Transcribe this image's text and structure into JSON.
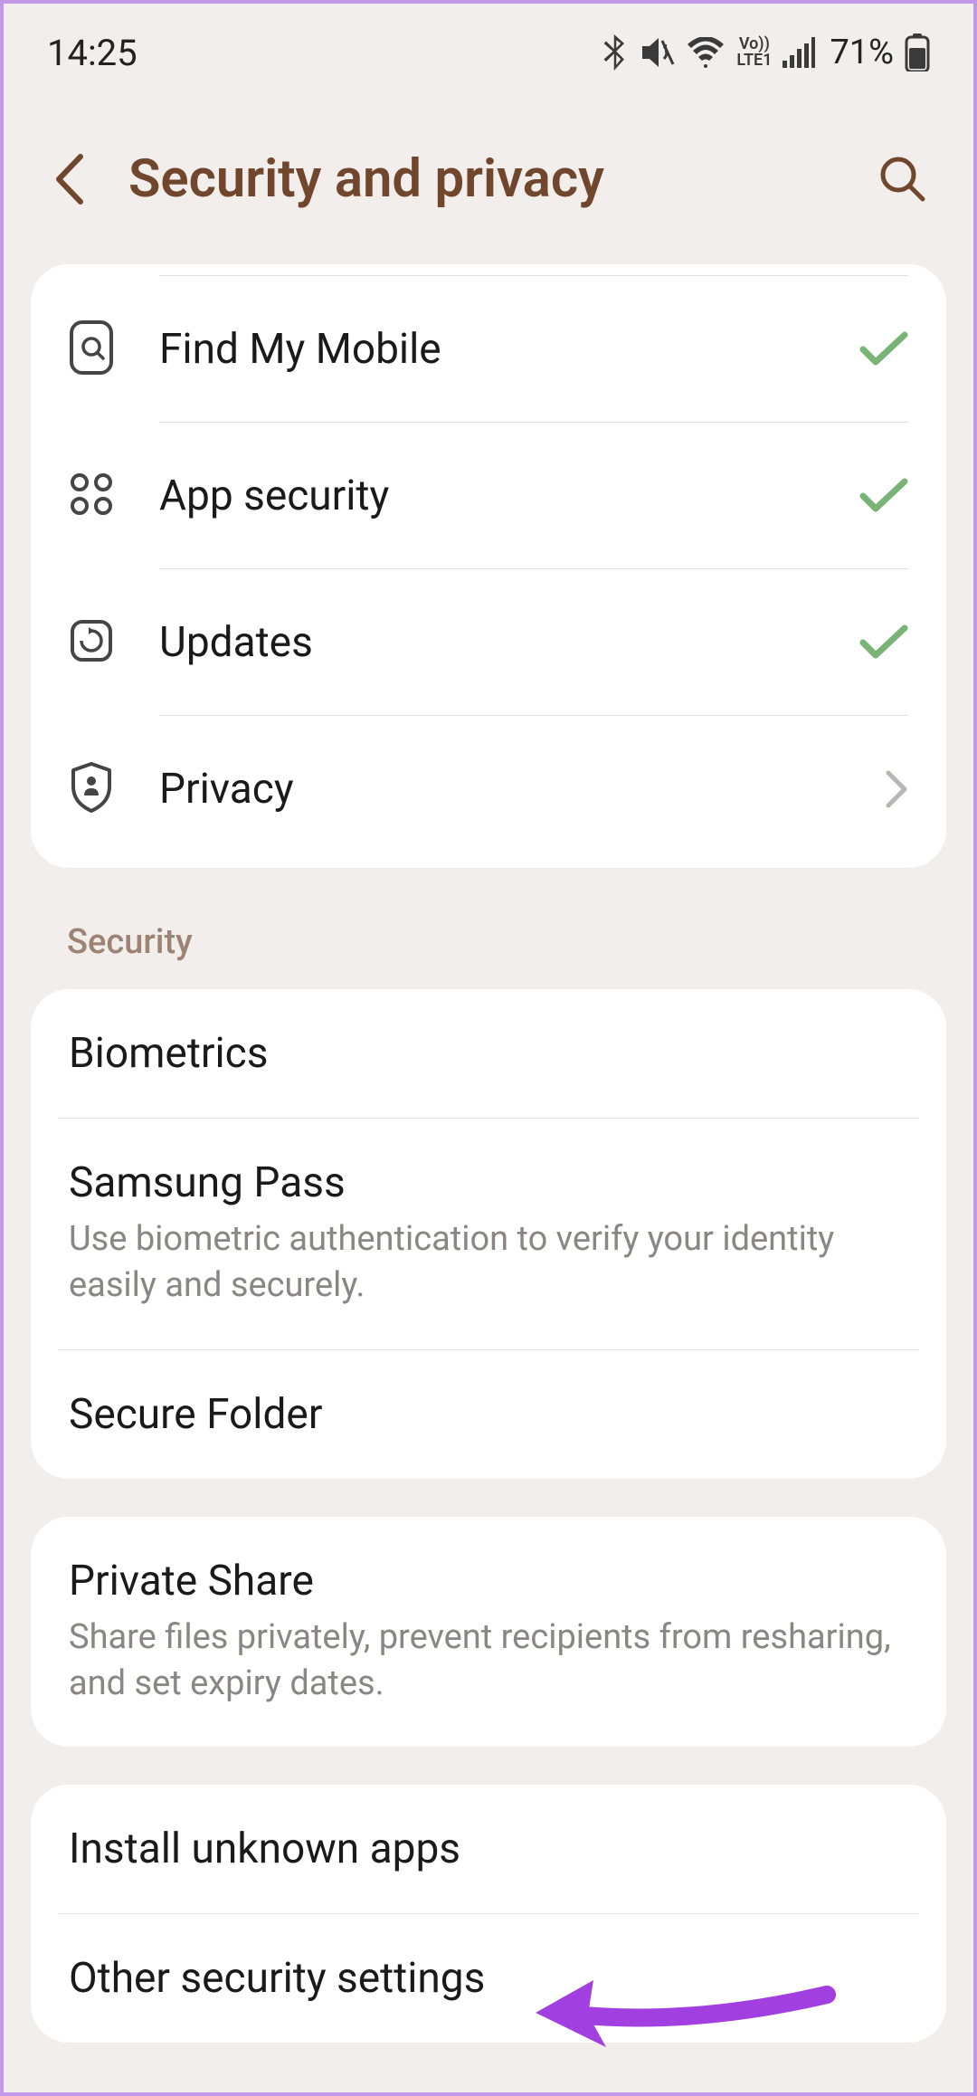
{
  "status_bar": {
    "time": "14:25",
    "battery_pct": "71%"
  },
  "header": {
    "title": "Security and privacy"
  },
  "top_list": {
    "items": [
      {
        "label": "Find My Mobile",
        "status": "check"
      },
      {
        "label": "App security",
        "status": "check"
      },
      {
        "label": "Updates",
        "status": "check"
      },
      {
        "label": "Privacy",
        "status": "chevron"
      }
    ]
  },
  "section1": {
    "header": "Security",
    "items": [
      {
        "title": "Biometrics",
        "subtitle": ""
      },
      {
        "title": "Samsung Pass",
        "subtitle": "Use biometric authentication to verify your identity easily and securely."
      },
      {
        "title": "Secure Folder",
        "subtitle": ""
      }
    ]
  },
  "section2": {
    "items": [
      {
        "title": "Private Share",
        "subtitle": "Share files privately, prevent recipients from resharing, and set expiry dates."
      }
    ]
  },
  "section3": {
    "items": [
      {
        "title": "Install unknown apps",
        "subtitle": ""
      },
      {
        "title": "Other security settings",
        "subtitle": ""
      }
    ]
  }
}
